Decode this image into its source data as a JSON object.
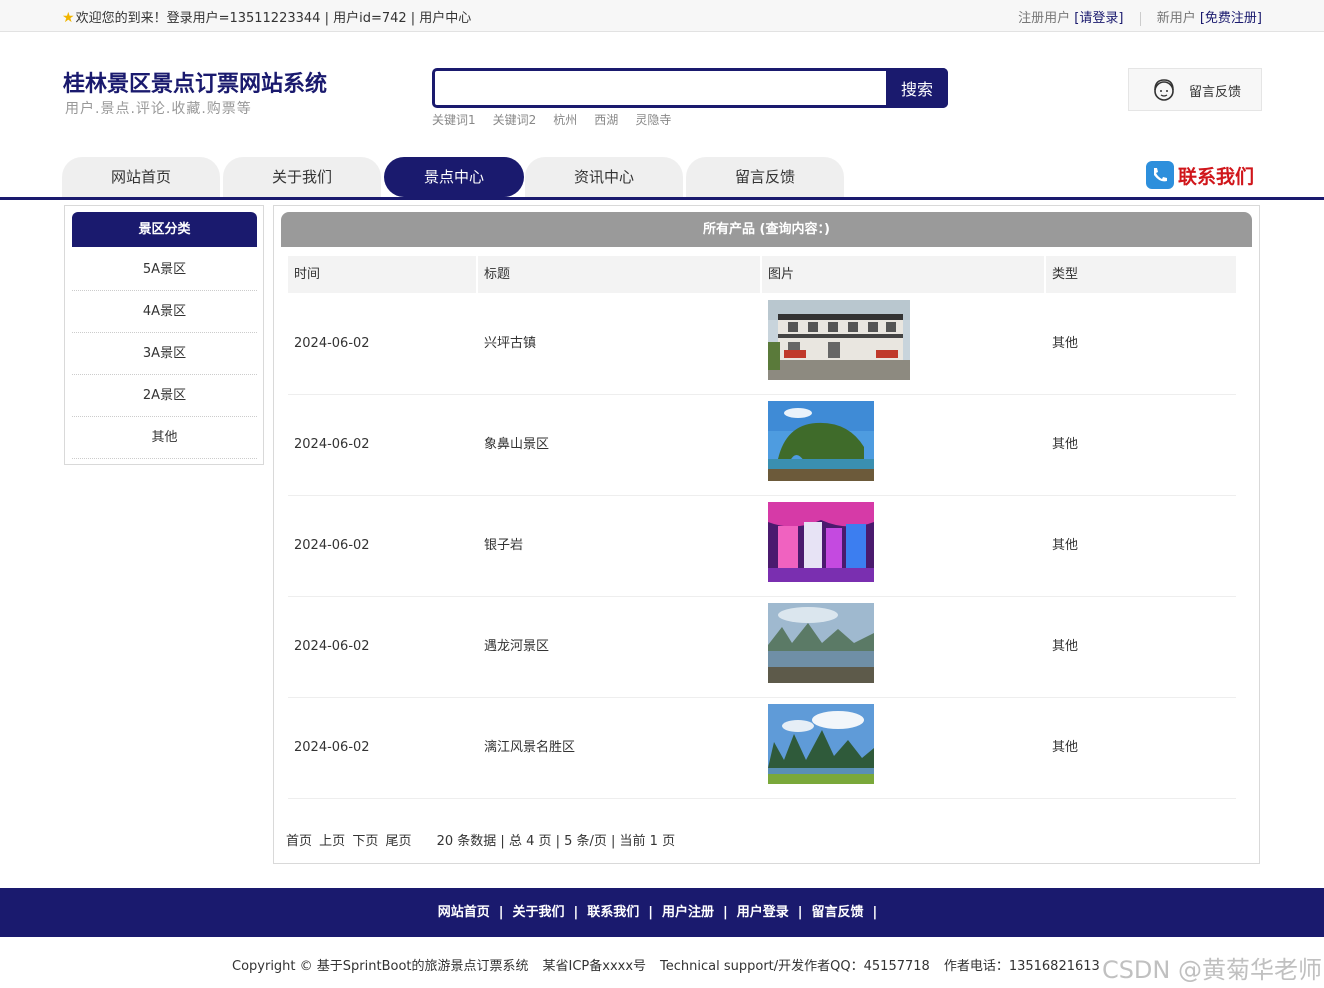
{
  "topbar": {
    "welcome": "欢迎您的到来！登录用户=13511223344 | 用户id=742 | 用户中心",
    "register_prefix": "注册用户",
    "login_link": "[请登录]",
    "newuser_prefix": "新用户",
    "signup_link": "[免费注册]"
  },
  "header": {
    "site_title": "桂林景区景点订票网站系统",
    "site_subtitle": "用户.景点.评论.收藏.购票等",
    "search_placeholder": "",
    "search_button": "搜索",
    "hotwords": [
      "关键词1",
      "关键词2",
      "杭州",
      "西湖",
      "灵隐寺"
    ],
    "feedback_label": "留言反馈",
    "contact_label": "联系我们"
  },
  "nav": {
    "tabs": [
      "网站首页",
      "关于我们",
      "景点中心",
      "资讯中心",
      "留言反馈"
    ],
    "active_index": 2
  },
  "sidebar": {
    "title": "景区分类",
    "items": [
      "5A景区",
      "4A景区",
      "3A景区",
      "2A景区",
      "其他"
    ]
  },
  "content": {
    "title": "所有产品 (查询内容：)",
    "columns": [
      "时间",
      "标题",
      "图片",
      "类型"
    ],
    "rows": [
      {
        "time": "2024-06-02",
        "title": "兴坪古镇",
        "type": "其他",
        "image": "ancient-town-photo"
      },
      {
        "time": "2024-06-02",
        "title": "象鼻山景区",
        "type": "其他",
        "image": "elephant-trunk-hill-photo"
      },
      {
        "time": "2024-06-02",
        "title": "银子岩",
        "type": "其他",
        "image": "cave-photo"
      },
      {
        "time": "2024-06-02",
        "title": "遇龙河景区",
        "type": "其他",
        "image": "river-photo"
      },
      {
        "time": "2024-06-02",
        "title": "漓江风景名胜区",
        "type": "其他",
        "image": "li-river-photo"
      }
    ],
    "pager": {
      "links": [
        "首页",
        "上页",
        "下页",
        "尾页"
      ],
      "info": "20 条数据 | 总 4 页 | 5 条/页 | 当前 1 页"
    }
  },
  "footer": {
    "links": [
      "网站首页",
      "关于我们",
      "联系我们",
      "用户注册",
      "用户登录",
      "留言反馈"
    ],
    "copyright": "Copyright © 基于SprintBoot的旅游景点订票系统",
    "icp": "某省ICP备xxxx号",
    "support": "Technical support/开发作者QQ：45157718",
    "phone": "作者电话：13516821613",
    "watermark": "CSDN @黄菊华老师"
  },
  "colors": {
    "primary": "#1a1a6e",
    "accent_red": "#d0161b",
    "gray_header": "#9a9a9a"
  }
}
